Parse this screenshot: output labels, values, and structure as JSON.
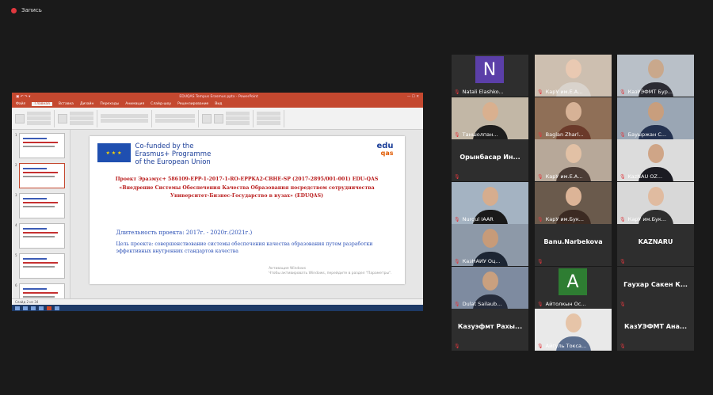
{
  "recording": {
    "label": "Запись",
    "color": "#e0383e"
  },
  "ppt": {
    "window_title": "EDUQAS Tempus Erasmus pptx - PowerPoint",
    "tabs": [
      "Файл",
      "Главная",
      "Вставка",
      "Дизайн",
      "Переходы",
      "Анимация",
      "Слайд-шоу",
      "Рецензирование",
      "Вид"
    ],
    "active_tab": "Главная",
    "thumbnail_numbers": [
      "1",
      "2",
      "3",
      "4",
      "5",
      "6"
    ],
    "status": "Слайд 2 из 34",
    "slide": {
      "eu_line1": "Co-funded by the",
      "eu_line2": "Erasmus+ Programme",
      "eu_line3": "of the European Union",
      "logo_top": "edu",
      "logo_bottom": "qas",
      "project_text": "Проект Эразмус+ 586109-EPP-1-2017-1-RO-EPPKA2-CBHE-SP (2017-2895/001-001) EDU-QAS «Внедрение Системы Обеспечения Качества Образования посредством сотрудничества Университет-Бизнес-Государство в вузах» (EDUQAS)",
      "duration": "Длительность проекта: 2017г. - 2020г.(2021г.)",
      "goal": "Цель проекта: совершенствование системы обеспечения качества образования путем разработки эффективных внутренних стандартов качества",
      "activate_line1": "Активация Windows",
      "activate_line2": "Чтобы активировать Windows, перейдите в раздел \"Параметры\"."
    }
  },
  "participants": [
    {
      "name": "Natali Elashko...",
      "type": "letter",
      "letter": "N",
      "bg": "#5b3fa8"
    },
    {
      "name": "КарУ им.Е.А...",
      "type": "video",
      "skin": "#e9c9b2",
      "shirt": "#d9d3cc",
      "bg": "#cdbfb0"
    },
    {
      "name": "КазУЭФМТ Бур...",
      "type": "video",
      "skin": "#c9a88c",
      "shirt": "#2b2b33",
      "bg": "#b9c0c8",
      "speaking": true
    },
    {
      "name": "Таншолпан...",
      "type": "video",
      "skin": "#d9b08f",
      "shirt": "#1d1d1d",
      "bg": "#c2b7a6"
    },
    {
      "name": "Baglan Zharl...",
      "type": "video",
      "skin": "#d7b296",
      "shirt": "#6b3a2a",
      "bg": "#8f6f57"
    },
    {
      "name": "Бауыржан С...",
      "type": "video",
      "skin": "#c89e7d",
      "shirt": "#23314f",
      "bg": "#9aa6b4"
    },
    {
      "name": "Орынбасар Ин...",
      "type": "name"
    },
    {
      "name": "КарУ им.Е.А...",
      "type": "video",
      "skin": "#e2c1a5",
      "shirt": "#4b3c35",
      "bg": "#b7a899"
    },
    {
      "name": "KazNAU OZ...",
      "type": "video",
      "skin": "#cfa587",
      "shirt": "#1b1b22",
      "bg": "#dcdcdc"
    },
    {
      "name": "Nurgul IAAR",
      "type": "video",
      "skin": "#d6ad8e",
      "shirt": "#1a1a1a",
      "bg": "#a4b3c2"
    },
    {
      "name": "КарУ им.Бук...",
      "type": "video",
      "skin": "#dcb497",
      "shirt": "#3b2a22",
      "bg": "#6a5a4c"
    },
    {
      "name": "КарУ им.Бук...",
      "type": "video",
      "skin": "#e0bba0",
      "shirt": "#2e2e2e",
      "bg": "#d8d8d8"
    },
    {
      "name": "КазНАИУ Оц...",
      "type": "video",
      "skin": "#c79b79",
      "shirt": "#1c2533",
      "bg": "#8d99a8"
    },
    {
      "name": "Banu.Narbekova",
      "type": "name"
    },
    {
      "name": "KAZNARU",
      "type": "name"
    },
    {
      "name": "Dulat Sailaub...",
      "type": "video",
      "skin": "#c9a07f",
      "shirt": "#252b3a",
      "bg": "#7e8ba0"
    },
    {
      "name": "Айтолкын Ос...",
      "type": "letter",
      "letter": "A",
      "bg": "#2e7d32"
    },
    {
      "name": "Гаухар Сакен К...",
      "type": "name"
    },
    {
      "name": "Казуэфмт Рахы...",
      "type": "name"
    },
    {
      "name": "Айгуль Токса...",
      "type": "video",
      "skin": "#e6c4a8",
      "shirt": "#5c6f8f",
      "bg": "#e9e9e9"
    },
    {
      "name": "КазУЭФМТ Ана...",
      "type": "name"
    }
  ]
}
